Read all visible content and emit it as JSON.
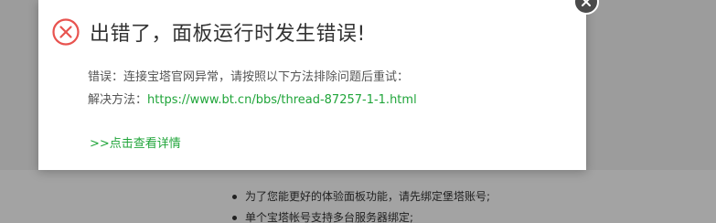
{
  "dialog": {
    "title": "出错了，面板运行时发生错误!",
    "error_line": "错误：连接宝塔官网异常，请按照以下方法排除问题后重试：",
    "solution_label": "解决方法：",
    "solution_url": "https://www.bt.cn/bbs/thread-87257-1-1.html",
    "details_link": ">>点击查看详情",
    "icon": "error-circle-x-icon",
    "close_icon": "close-icon"
  },
  "background": {
    "bullets": [
      "为了您能更好的体验面板功能，请先绑定堡塔账号;",
      "单个宝塔帐号支持多台服务器绑定;"
    ]
  },
  "colors": {
    "accent_green": "#20a53a",
    "error_red": "#e8534f",
    "title_text": "#333333",
    "overlay": "#9c9c9c"
  }
}
